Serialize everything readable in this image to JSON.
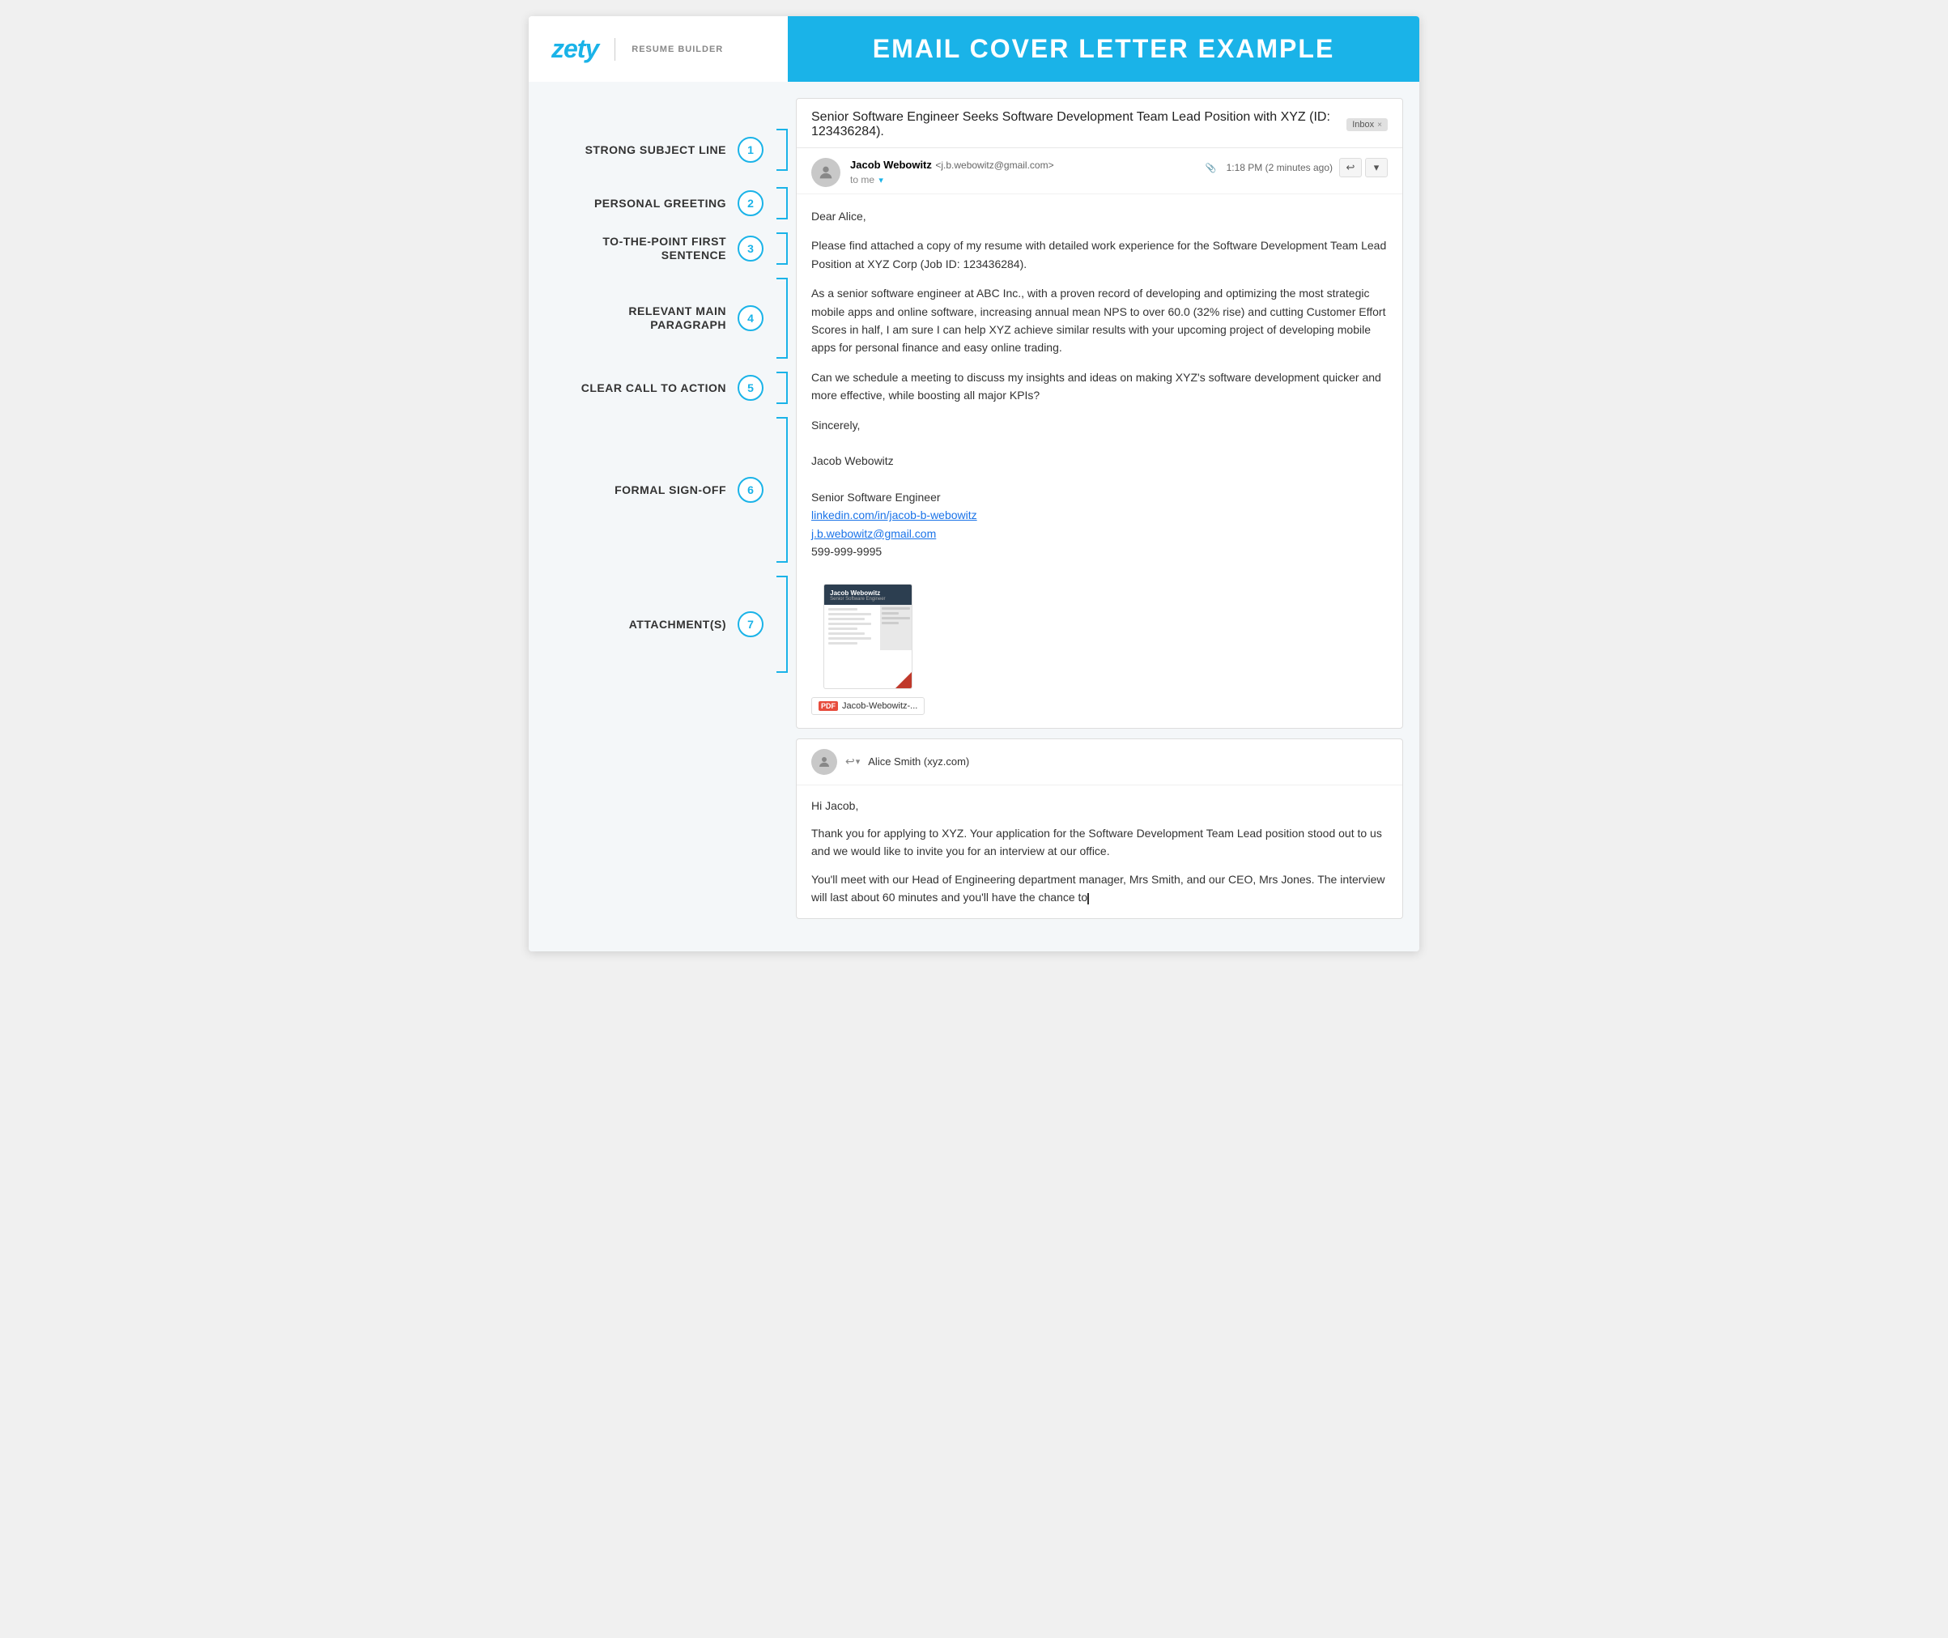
{
  "header": {
    "logo_text": "zety",
    "logo_subtitle": "RESUME BUILDER",
    "title": "EMAIL COVER LETTER EXAMPLE"
  },
  "sidebar": {
    "items": [
      {
        "id": 1,
        "label": "STRONG SUBJECT LINE",
        "bracket_size": "normal"
      },
      {
        "id": 2,
        "label": "PERSONAL GREETING",
        "bracket_size": "normal"
      },
      {
        "id": 3,
        "label": "TO-THE-POINT FIRST SENTENCE",
        "bracket_size": "normal"
      },
      {
        "id": 4,
        "label": "RELEVANT MAIN PARAGRAPH",
        "bracket_size": "tall"
      },
      {
        "id": 5,
        "label": "CLEAR CALL TO ACTION",
        "bracket_size": "normal"
      },
      {
        "id": 6,
        "label": "FORMAL SIGN-OFF",
        "bracket_size": "tallest"
      },
      {
        "id": 7,
        "label": "ATTACHMENT(S)",
        "bracket_size": "taller"
      }
    ]
  },
  "email": {
    "subject": "Senior Software Engineer Seeks Software Development Team Lead Position with XYZ (ID: 123436284).",
    "inbox_label": "Inbox",
    "inbox_x": "×",
    "from_name": "Jacob Webowitz",
    "from_email": "j.b.webowitz@gmail.com",
    "to_label": "to me",
    "time": "1:18 PM (2 minutes ago)",
    "greeting": "Dear Alice,",
    "paragraph1": "Please find attached a copy of my resume with detailed work experience for the Software Development Team Lead Position at XYZ Corp (Job ID: 123436284).",
    "paragraph2": "As a senior software engineer at ABC Inc., with a proven record of developing and optimizing the most strategic mobile apps and online software, increasing annual mean NPS to over 60.0 (32% rise) and cutting Customer Effort Scores in half, I am sure I can help XYZ achieve similar results with your upcoming project of developing mobile apps for personal finance and easy online trading.",
    "paragraph3": "Can we schedule a meeting to discuss my insights and ideas on making XYZ's software development quicker and more effective, while boosting all major KPIs?",
    "closing": "Sincerely,",
    "name": "Jacob Webowitz",
    "job_title": "Senior Software Engineer",
    "linkedin": "linkedin.com/in/jacob-b-webowitz",
    "email_addr": "j.b.webowitz@gmail.com",
    "phone": "599-999-9995",
    "attachment_name": "Jacob-Webowitz-...",
    "resume_name": "Jacob Webowitz",
    "resume_title": "Senior Software Engineer"
  },
  "reply": {
    "from_name": "Alice Smith (xyz.com)",
    "greeting": "Hi Jacob,",
    "paragraph1": "Thank you for applying to XYZ. Your application for the Software Development Team Lead position stood out to us and we would like to invite you for an interview at our office.",
    "paragraph2": "You'll meet with our Head of Engineering department manager, Mrs Smith, and our CEO, Mrs Jones. The interview will last about 60 minutes and you'll have the chance to"
  },
  "colors": {
    "accent": "#1ab3e8",
    "text_dark": "#333333",
    "text_light": "#888888",
    "link_blue": "#1a73e8",
    "pdf_red": "#e74c3c"
  }
}
